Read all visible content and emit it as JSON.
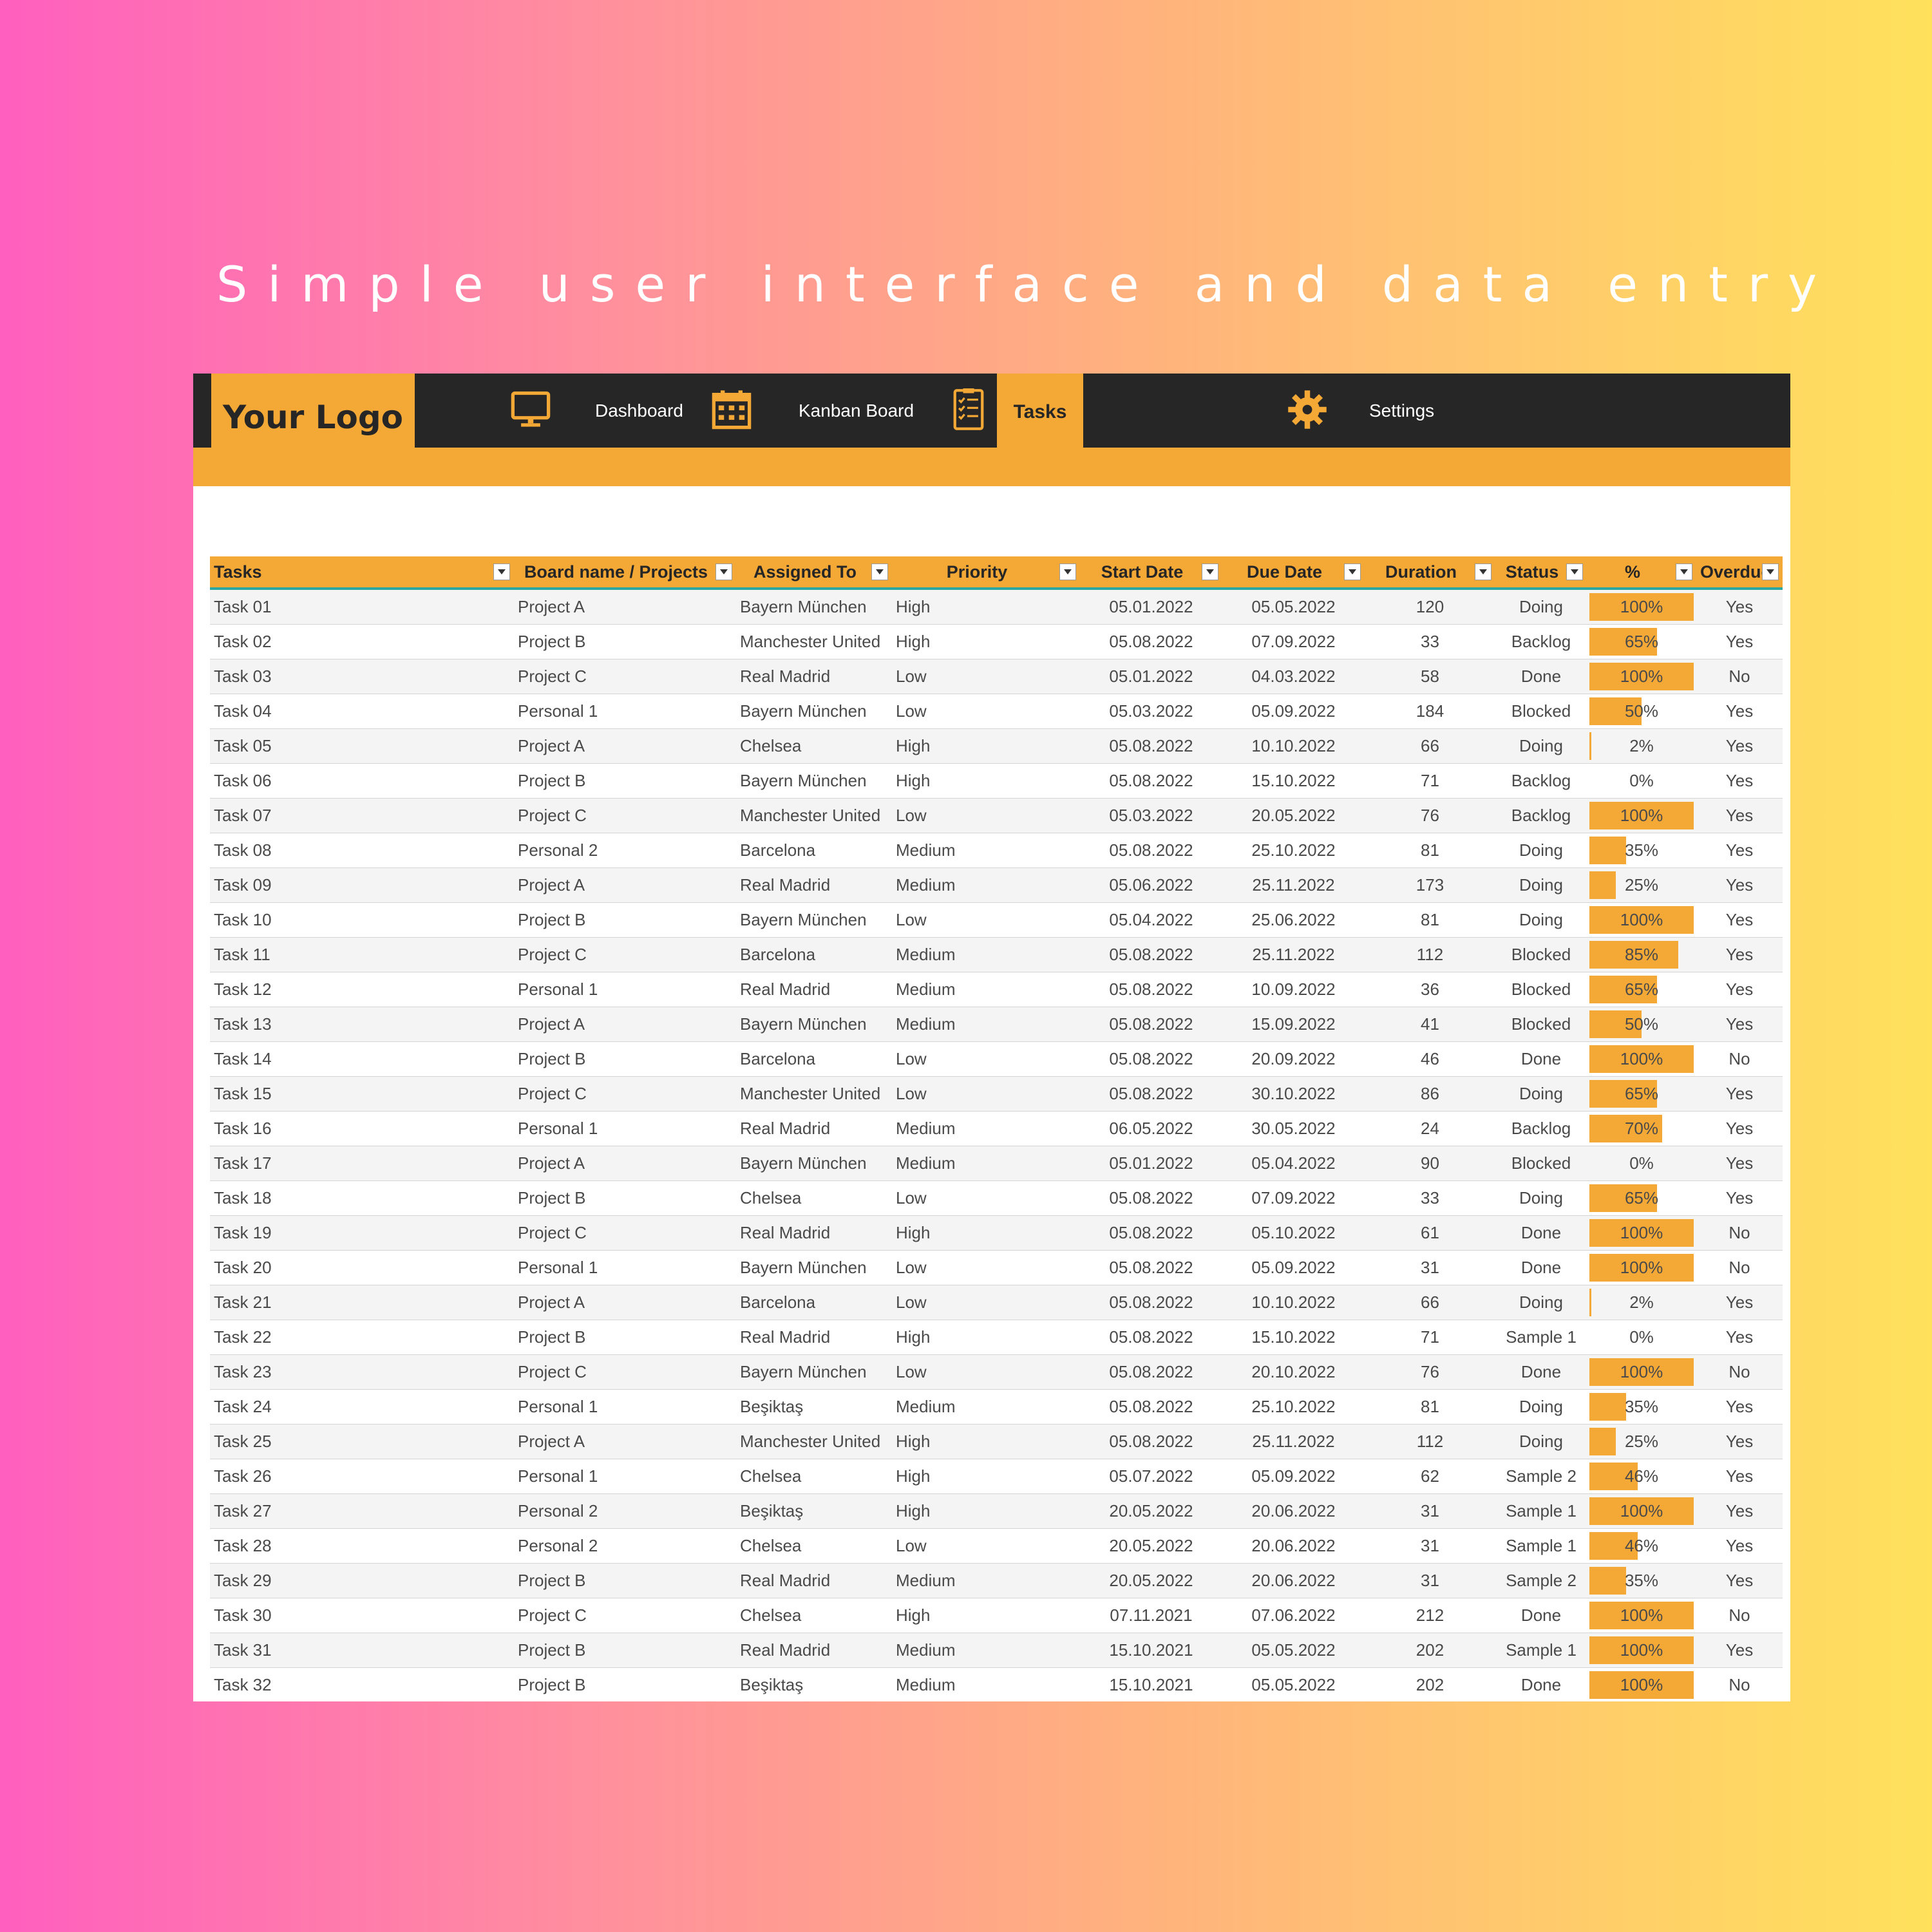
{
  "headline": "Simple user interface and data entry",
  "app": {
    "logo": "Your Logo",
    "nav": {
      "dashboard": "Dashboard",
      "kanban": "Kanban Board",
      "tasks": "Tasks",
      "settings": "Settings"
    },
    "accent_color": "#f4a835",
    "dark_color": "#262626"
  },
  "table": {
    "columns": [
      "Tasks",
      "Board name / Projects",
      "Assigned To",
      "Priority",
      "Start Date",
      "Due Date",
      "Duration",
      "Status",
      "%",
      "Overdue"
    ],
    "rows": [
      {
        "task": "Task 01",
        "board": "Project A",
        "assigned": "Bayern München",
        "priority": "High",
        "start": "05.01.2022",
        "due": "05.05.2022",
        "duration": "120",
        "status": "Doing",
        "pct": "100%",
        "progress": 1.0,
        "overdue": "Yes"
      },
      {
        "task": "Task 02",
        "board": "Project B",
        "assigned": "Manchester United",
        "priority": "High",
        "start": "05.08.2022",
        "due": "07.09.2022",
        "duration": "33",
        "status": "Backlog",
        "pct": "65%",
        "progress": 0.65,
        "overdue": "Yes"
      },
      {
        "task": "Task 03",
        "board": "Project C",
        "assigned": "Real Madrid",
        "priority": "Low",
        "start": "05.01.2022",
        "due": "04.03.2022",
        "duration": "58",
        "status": "Done",
        "pct": "100%",
        "progress": 1.0,
        "overdue": "No"
      },
      {
        "task": "Task 04",
        "board": "Personal 1",
        "assigned": "Bayern München",
        "priority": "Low",
        "start": "05.03.2022",
        "due": "05.09.2022",
        "duration": "184",
        "status": "Blocked",
        "pct": "50%",
        "progress": 0.5,
        "overdue": "Yes"
      },
      {
        "task": "Task 05",
        "board": "Project A",
        "assigned": "Chelsea",
        "priority": "High",
        "start": "05.08.2022",
        "due": "10.10.2022",
        "duration": "66",
        "status": "Doing",
        "pct": "2%",
        "progress": 0.02,
        "overdue": "Yes"
      },
      {
        "task": "Task 06",
        "board": "Project B",
        "assigned": "Bayern München",
        "priority": "High",
        "start": "05.08.2022",
        "due": "15.10.2022",
        "duration": "71",
        "status": "Backlog",
        "pct": "0%",
        "progress": 0.0,
        "overdue": "Yes"
      },
      {
        "task": "Task 07",
        "board": "Project C",
        "assigned": "Manchester United",
        "priority": "Low",
        "start": "05.03.2022",
        "due": "20.05.2022",
        "duration": "76",
        "status": "Backlog",
        "pct": "100%",
        "progress": 1.0,
        "overdue": "Yes"
      },
      {
        "task": "Task 08",
        "board": "Personal 2",
        "assigned": "Barcelona",
        "priority": "Medium",
        "start": "05.08.2022",
        "due": "25.10.2022",
        "duration": "81",
        "status": "Doing",
        "pct": "35%",
        "progress": 0.35,
        "overdue": "Yes"
      },
      {
        "task": "Task 09",
        "board": "Project A",
        "assigned": "Real Madrid",
        "priority": "Medium",
        "start": "05.06.2022",
        "due": "25.11.2022",
        "duration": "173",
        "status": "Doing",
        "pct": "25%",
        "progress": 0.25,
        "overdue": "Yes"
      },
      {
        "task": "Task 10",
        "board": "Project B",
        "assigned": "Bayern München",
        "priority": "Low",
        "start": "05.04.2022",
        "due": "25.06.2022",
        "duration": "81",
        "status": "Doing",
        "pct": "100%",
        "progress": 1.0,
        "overdue": "Yes"
      },
      {
        "task": "Task 11",
        "board": "Project C",
        "assigned": "Barcelona",
        "priority": "Medium",
        "start": "05.08.2022",
        "due": "25.11.2022",
        "duration": "112",
        "status": "Blocked",
        "pct": "85%",
        "progress": 0.85,
        "overdue": "Yes"
      },
      {
        "task": "Task 12",
        "board": "Personal 1",
        "assigned": "Real Madrid",
        "priority": "Medium",
        "start": "05.08.2022",
        "due": "10.09.2022",
        "duration": "36",
        "status": "Blocked",
        "pct": "65%",
        "progress": 0.65,
        "overdue": "Yes"
      },
      {
        "task": "Task 13",
        "board": "Project A",
        "assigned": "Bayern München",
        "priority": "Medium",
        "start": "05.08.2022",
        "due": "15.09.2022",
        "duration": "41",
        "status": "Blocked",
        "pct": "50%",
        "progress": 0.5,
        "overdue": "Yes"
      },
      {
        "task": "Task 14",
        "board": "Project B",
        "assigned": "Barcelona",
        "priority": "Low",
        "start": "05.08.2022",
        "due": "20.09.2022",
        "duration": "46",
        "status": "Done",
        "pct": "100%",
        "progress": 1.0,
        "overdue": "No"
      },
      {
        "task": "Task 15",
        "board": "Project C",
        "assigned": "Manchester United",
        "priority": "Low",
        "start": "05.08.2022",
        "due": "30.10.2022",
        "duration": "86",
        "status": "Doing",
        "pct": "65%",
        "progress": 0.65,
        "overdue": "Yes"
      },
      {
        "task": "Task 16",
        "board": "Personal 1",
        "assigned": "Real Madrid",
        "priority": "Medium",
        "start": "06.05.2022",
        "due": "30.05.2022",
        "duration": "24",
        "status": "Backlog",
        "pct": "70%",
        "progress": 0.7,
        "overdue": "Yes"
      },
      {
        "task": "Task 17",
        "board": "Project A",
        "assigned": "Bayern München",
        "priority": "Medium",
        "start": "05.01.2022",
        "due": "05.04.2022",
        "duration": "90",
        "status": "Blocked",
        "pct": "0%",
        "progress": 0.0,
        "overdue": "Yes"
      },
      {
        "task": "Task 18",
        "board": "Project B",
        "assigned": "Chelsea",
        "priority": "Low",
        "start": "05.08.2022",
        "due": "07.09.2022",
        "duration": "33",
        "status": "Doing",
        "pct": "65%",
        "progress": 0.65,
        "overdue": "Yes"
      },
      {
        "task": "Task 19",
        "board": "Project C",
        "assigned": "Real Madrid",
        "priority": "High",
        "start": "05.08.2022",
        "due": "05.10.2022",
        "duration": "61",
        "status": "Done",
        "pct": "100%",
        "progress": 1.0,
        "overdue": "No"
      },
      {
        "task": "Task 20",
        "board": "Personal 1",
        "assigned": "Bayern München",
        "priority": "Low",
        "start": "05.08.2022",
        "due": "05.09.2022",
        "duration": "31",
        "status": "Done",
        "pct": "100%",
        "progress": 1.0,
        "overdue": "No"
      },
      {
        "task": "Task 21",
        "board": "Project A",
        "assigned": "Barcelona",
        "priority": "Low",
        "start": "05.08.2022",
        "due": "10.10.2022",
        "duration": "66",
        "status": "Doing",
        "pct": "2%",
        "progress": 0.02,
        "overdue": "Yes"
      },
      {
        "task": "Task 22",
        "board": "Project B",
        "assigned": "Real Madrid",
        "priority": "High",
        "start": "05.08.2022",
        "due": "15.10.2022",
        "duration": "71",
        "status": "Sample 1",
        "pct": "0%",
        "progress": 0.0,
        "overdue": "Yes"
      },
      {
        "task": "Task 23",
        "board": "Project C",
        "assigned": "Bayern München",
        "priority": "Low",
        "start": "05.08.2022",
        "due": "20.10.2022",
        "duration": "76",
        "status": "Done",
        "pct": "100%",
        "progress": 1.0,
        "overdue": "No"
      },
      {
        "task": "Task 24",
        "board": "Personal 1",
        "assigned": "Beşiktaş",
        "priority": "Medium",
        "start": "05.08.2022",
        "due": "25.10.2022",
        "duration": "81",
        "status": "Doing",
        "pct": "35%",
        "progress": 0.35,
        "overdue": "Yes"
      },
      {
        "task": "Task 25",
        "board": "Project A",
        "assigned": "Manchester United",
        "priority": "High",
        "start": "05.08.2022",
        "due": "25.11.2022",
        "duration": "112",
        "status": "Doing",
        "pct": "25%",
        "progress": 0.25,
        "overdue": "Yes"
      },
      {
        "task": "Task 26",
        "board": "Personal 1",
        "assigned": "Chelsea",
        "priority": "High",
        "start": "05.07.2022",
        "due": "05.09.2022",
        "duration": "62",
        "status": "Sample 2",
        "pct": "46%",
        "progress": 0.46,
        "overdue": "Yes"
      },
      {
        "task": "Task 27",
        "board": "Personal 2",
        "assigned": "Beşiktaş",
        "priority": "High",
        "start": "20.05.2022",
        "due": "20.06.2022",
        "duration": "31",
        "status": "Sample 1",
        "pct": "100%",
        "progress": 1.0,
        "overdue": "Yes"
      },
      {
        "task": "Task 28",
        "board": "Personal 2",
        "assigned": "Chelsea",
        "priority": "Low",
        "start": "20.05.2022",
        "due": "20.06.2022",
        "duration": "31",
        "status": "Sample 1",
        "pct": "46%",
        "progress": 0.46,
        "overdue": "Yes"
      },
      {
        "task": "Task 29",
        "board": "Project B",
        "assigned": "Real Madrid",
        "priority": "Medium",
        "start": "20.05.2022",
        "due": "20.06.2022",
        "duration": "31",
        "status": "Sample 2",
        "pct": "35%",
        "progress": 0.35,
        "overdue": "Yes"
      },
      {
        "task": "Task 30",
        "board": "Project C",
        "assigned": "Chelsea",
        "priority": "High",
        "start": "07.11.2021",
        "due": "07.06.2022",
        "duration": "212",
        "status": "Done",
        "pct": "100%",
        "progress": 1.0,
        "overdue": "No"
      },
      {
        "task": "Task 31",
        "board": "Project B",
        "assigned": "Real Madrid",
        "priority": "Medium",
        "start": "15.10.2021",
        "due": "05.05.2022",
        "duration": "202",
        "status": "Sample 1",
        "pct": "100%",
        "progress": 1.0,
        "overdue": "Yes"
      },
      {
        "task": "Task 32",
        "board": "Project B",
        "assigned": "Beşiktaş",
        "priority": "Medium",
        "start": "15.10.2021",
        "due": "05.05.2022",
        "duration": "202",
        "status": "Done",
        "pct": "100%",
        "progress": 1.0,
        "overdue": "No"
      }
    ]
  }
}
